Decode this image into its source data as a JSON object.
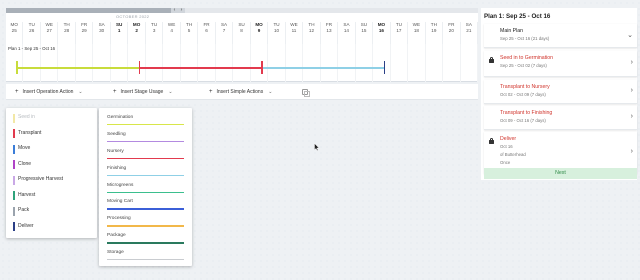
{
  "timeline": {
    "month": "OCTOBER 2022",
    "days": [
      {
        "dow": "MO",
        "num": "25"
      },
      {
        "dow": "TU",
        "num": "26"
      },
      {
        "dow": "WE",
        "num": "27"
      },
      {
        "dow": "TH",
        "num": "28"
      },
      {
        "dow": "FR",
        "num": "29"
      },
      {
        "dow": "SA",
        "num": "30"
      },
      {
        "dow": "SU",
        "num": "1",
        "bold": true
      },
      {
        "dow": "MO",
        "num": "2",
        "bold": true
      },
      {
        "dow": "TU",
        "num": "3"
      },
      {
        "dow": "WE",
        "num": "4"
      },
      {
        "dow": "TH",
        "num": "5"
      },
      {
        "dow": "FR",
        "num": "6"
      },
      {
        "dow": "SA",
        "num": "7"
      },
      {
        "dow": "SU",
        "num": "8"
      },
      {
        "dow": "MO",
        "num": "9",
        "bold": true
      },
      {
        "dow": "TU",
        "num": "10"
      },
      {
        "dow": "WE",
        "num": "11"
      },
      {
        "dow": "TH",
        "num": "12"
      },
      {
        "dow": "FR",
        "num": "13"
      },
      {
        "dow": "SA",
        "num": "14"
      },
      {
        "dow": "SU",
        "num": "15"
      },
      {
        "dow": "MO",
        "num": "16",
        "bold": true
      },
      {
        "dow": "TU",
        "num": "17"
      },
      {
        "dow": "WE",
        "num": "18"
      },
      {
        "dow": "TH",
        "num": "19"
      },
      {
        "dow": "FR",
        "num": "20"
      },
      {
        "dow": "SA",
        "num": "21"
      }
    ],
    "plan_label": "Plan 1 - Sep 25 - Oct 16",
    "colors": {
      "seed": "#c8dc3c",
      "germination": "#e23a4e",
      "nursery": "#e23a4e",
      "finishing": "#8fd0e6",
      "deliver": "#2b3f86"
    }
  },
  "toolbar": {
    "operation": "Insert Operation Action",
    "stage": "Insert Stage Usage",
    "simple": "Insert Simple Actions"
  },
  "operation_menu": {
    "items": [
      {
        "label": "Seed in",
        "color": "#f2e8a6",
        "muted": true
      },
      {
        "label": "Transplant",
        "color": "#e23a4e"
      },
      {
        "label": "Move",
        "color": "#3b7dd8"
      },
      {
        "label": "Clone",
        "color": "#b044c7"
      },
      {
        "label": "Progressive Harvest",
        "color": "#c9a8e6"
      },
      {
        "label": "Harvest",
        "color": "#2fa37c"
      },
      {
        "label": "Pack",
        "color": "#9aa3ad"
      },
      {
        "label": "Deliver",
        "color": "#2b3f86"
      }
    ]
  },
  "stage_menu": {
    "items": [
      {
        "label": "Germination",
        "color": "#d8e64a"
      },
      {
        "label": "Seedling",
        "color": "#b38ae0"
      },
      {
        "label": "Nursery",
        "color": "#e23a4e"
      },
      {
        "label": "Finishing",
        "color": "#8fd0e6"
      },
      {
        "label": "Microgreens",
        "color": "#3bbf8e"
      },
      {
        "label": "Moving Cart",
        "color": "#3b5fd8"
      },
      {
        "label": "Processing",
        "color": "#f2b84a"
      },
      {
        "label": "Package",
        "color": "#2a7a5e"
      },
      {
        "label": "Storage",
        "color": "#c9ccd0"
      }
    ]
  },
  "panel": {
    "title": "Plan 1: Sep 25 - Oct 16",
    "cards": [
      {
        "name": "Main Plan",
        "sub": "Sep 25 - Oct 16 (21 days)",
        "locked": false,
        "color": "#222",
        "chevron": "⌄"
      },
      {
        "name": "Seed in to Germination",
        "sub": "Sep 25 - Oct 02 (7 days)",
        "locked": true,
        "color": "#d0342c",
        "chevron": "›"
      },
      {
        "name": "Transplant to Nursery",
        "sub": "Oct 02 - Oct 09 (7 days)",
        "locked": false,
        "color": "#d0342c",
        "chevron": "›"
      },
      {
        "name": "Transplant to Finishing",
        "sub": "Oct 09 - Oct 16 (7 days)",
        "locked": false,
        "color": "#d0342c",
        "chevron": "›"
      },
      {
        "name": "Deliver",
        "sub": "Oct 16",
        "sub2": "of Butterhead",
        "sub3": "Once",
        "locked": true,
        "color": "#d0342c",
        "chevron": "›"
      }
    ],
    "next": "Next"
  }
}
